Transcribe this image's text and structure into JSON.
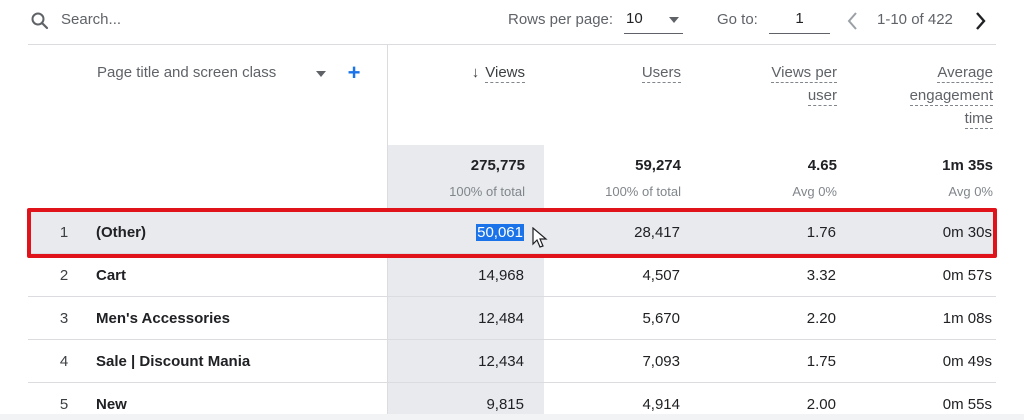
{
  "toolbar": {
    "search_placeholder": "Search...",
    "rows_per_page_label": "Rows per page:",
    "rows_per_page_value": "10",
    "goto_label": "Go to:",
    "goto_value": "1",
    "page_range": "1-10 of 422"
  },
  "header": {
    "dimension": "Page title and screen class",
    "views": "Views",
    "users": "Users",
    "views_per_user_line1": "Views per",
    "views_per_user_line2": "user",
    "aet_line1": "Average",
    "aet_line2": "engagement",
    "aet_line3": "time"
  },
  "totals": {
    "views": "275,775",
    "views_sub": "100% of total",
    "users": "59,274",
    "users_sub": "100% of total",
    "vpu": "4.65",
    "vpu_sub": "Avg 0%",
    "aet": "1m 35s",
    "aet_sub": "Avg 0%"
  },
  "rows": [
    {
      "rank": "1",
      "title": "(Other)",
      "views": "50,061",
      "users": "28,417",
      "vpu": "1.76",
      "aet": "0m 30s"
    },
    {
      "rank": "2",
      "title": "Cart",
      "views": "14,968",
      "users": "4,507",
      "vpu": "3.32",
      "aet": "0m 57s"
    },
    {
      "rank": "3",
      "title": "Men's Accessories",
      "views": "12,484",
      "users": "5,670",
      "vpu": "2.20",
      "aet": "1m 08s"
    },
    {
      "rank": "4",
      "title": "Sale | Discount Mania",
      "views": "12,434",
      "users": "7,093",
      "vpu": "1.75",
      "aet": "0m 49s"
    },
    {
      "rank": "5",
      "title": "New",
      "views": "9,815",
      "users": "4,914",
      "vpu": "2.00",
      "aet": "0m 55s"
    }
  ],
  "icons": {
    "search": "search-icon",
    "prev": "chevron-left-icon",
    "next": "chevron-right-icon",
    "add": "plus-icon",
    "sort": "arrow-down-icon",
    "cursor": "mouse-cursor-icon"
  },
  "colors": {
    "highlight_border": "#e0121a",
    "selection": "#1a73e8",
    "accent": "#1a73e8"
  }
}
